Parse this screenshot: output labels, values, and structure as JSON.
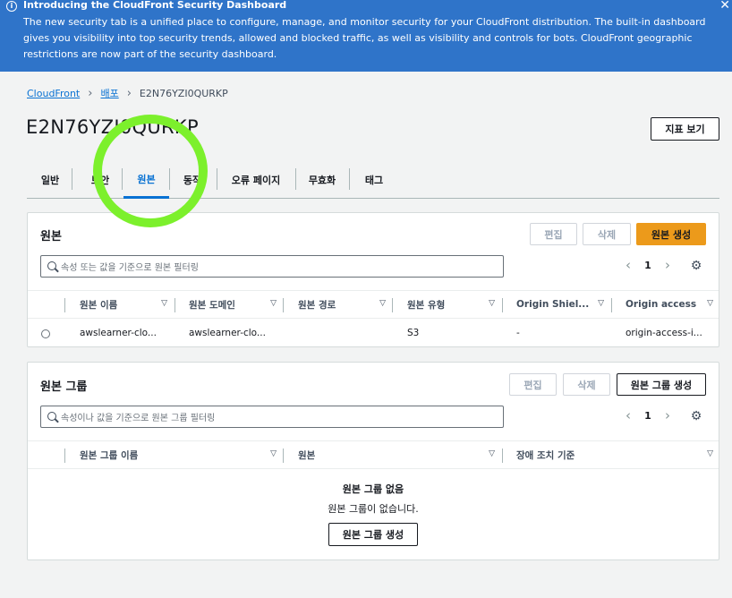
{
  "banner": {
    "title": "Introducing the CloudFront Security Dashboard",
    "body": "The new security tab is a unified place to configure, manage, and monitor security for your CloudFront distribution. The built-in dashboard gives you visibility into top security trends, allowed and blocked traffic, as well as visibility and controls for bots. CloudFront geographic restrictions are now part of the security dashboard.",
    "info_icon": "ⓘ",
    "close_icon": "✕"
  },
  "breadcrumb": {
    "items": [
      "CloudFront",
      "배포"
    ],
    "current": "E2N76YZI0QURKP",
    "separator": "›"
  },
  "page": {
    "title": "E2N76YZI0QURKP",
    "view_metrics_label": "지표 보기"
  },
  "tabs": [
    "일반",
    "보안",
    "원본",
    "동작",
    "오류 페이지",
    "무효화",
    "태그"
  ],
  "active_tab": "원본",
  "origins": {
    "title": "원본",
    "edit_label": "편집",
    "delete_label": "삭제",
    "create_label": "원본 생성",
    "filter_placeholder": "속성 또는 값을 기준으로 원본 필터링",
    "page": "1",
    "columns": [
      "원본 이름",
      "원본 도메인",
      "원본 경로",
      "원본 유형",
      "Origin Shiel...",
      "Origin access"
    ],
    "rows": [
      [
        "awslearner-clo...",
        "awslearner-clo...",
        "",
        "S3",
        "-",
        "origin-access-i..."
      ]
    ]
  },
  "origin_groups": {
    "title": "원본 그룹",
    "edit_label": "편집",
    "delete_label": "삭제",
    "create_label": "원본 그룹 생성",
    "filter_placeholder": "속성이나 값을 기준으로 원본 그룹 필터링",
    "page": "1",
    "columns": [
      "원본 그룹 이름",
      "원본",
      "장애 조치 기준"
    ],
    "empty_title": "원본 그룹 없음",
    "empty_sub": "원본 그룹이 없습니다.",
    "empty_create_label": "원본 그룹 생성"
  },
  "pager": {
    "prev": "‹",
    "next": "›"
  },
  "icons": {
    "gear": "⚙",
    "sort": "▽"
  },
  "colors": {
    "banner": "#2f74c9",
    "primary": "#ec9a1b",
    "link": "#0972d3",
    "annotation_ring": "#7cf02c"
  }
}
